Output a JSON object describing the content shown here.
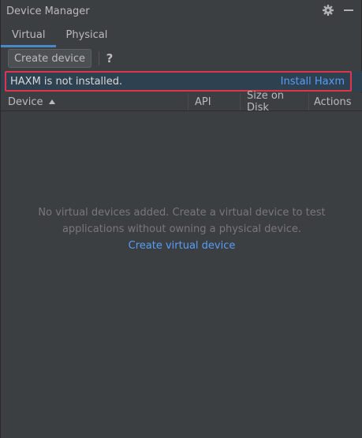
{
  "window": {
    "title": "Device Manager",
    "actions": [
      {
        "icon": "gear-icon",
        "label": ""
      },
      {
        "icon": "minimize-icon",
        "label": ""
      }
    ]
  },
  "tabs": [
    {
      "label": "Virtual",
      "active": true
    },
    {
      "label": "Physical",
      "active": false
    }
  ],
  "toolbar": {
    "create_label": "Create device",
    "help_label": "?"
  },
  "banner": {
    "message": "HAXM is not installed.",
    "action_label": "Install Haxm"
  },
  "table": {
    "columns": [
      "Device",
      "API",
      "Size on Disk",
      "Actions"
    ],
    "sort_column": "Device",
    "sort_direction": "ascending",
    "rows": []
  },
  "empty_state": {
    "line1": "No virtual devices added. Create a virtual device to test",
    "line2": "applications without owning a physical device.",
    "link_label": "Create virtual device"
  },
  "colors": {
    "background": "#3c3f41",
    "accent": "#4a88c7",
    "link": "#589df6",
    "banner_bg": "#2d4150",
    "highlight_outline": "#e0344d"
  }
}
